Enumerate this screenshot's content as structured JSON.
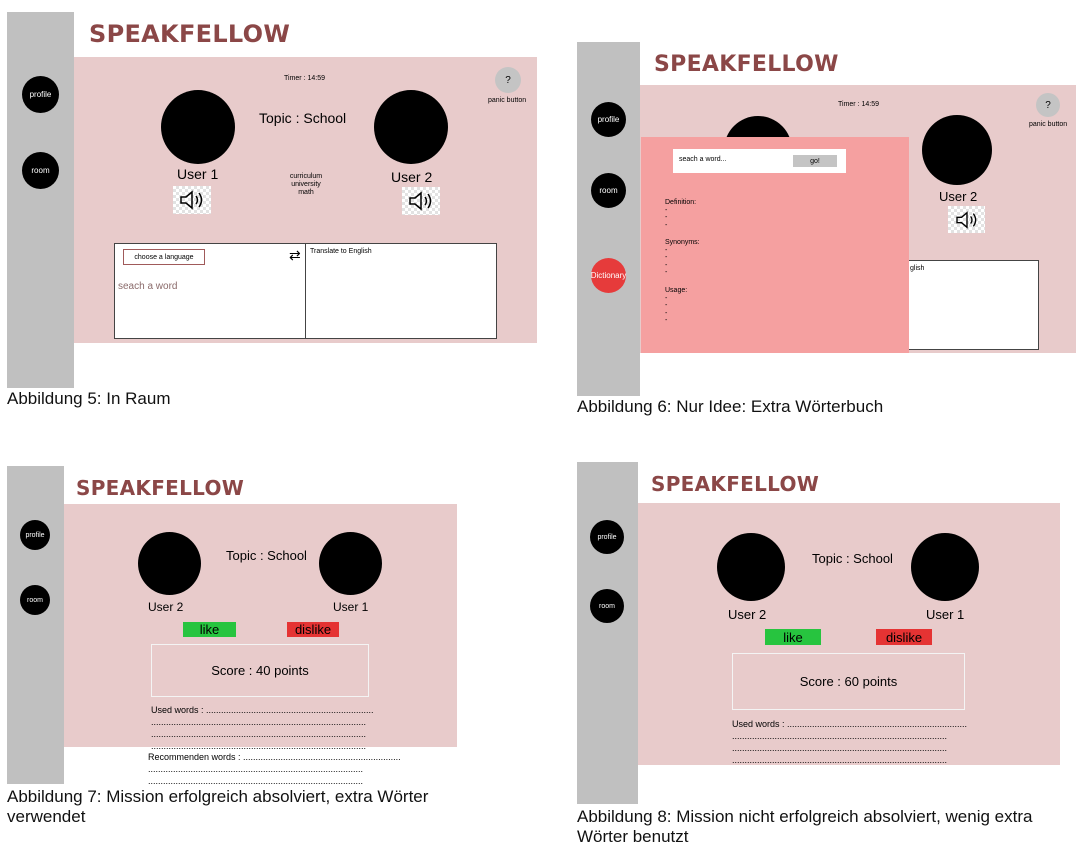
{
  "brand": "SPEAKFELLOW",
  "nav": {
    "profile": "profile",
    "room": "room",
    "dictionary": "Dictionary"
  },
  "fig5": {
    "timer": "Timer : 14:59",
    "panic_icon": "?",
    "panic_label": "panic button",
    "topic": "Topic : School",
    "user_left": "User 1",
    "user_right": "User 2",
    "words": [
      "curriculum",
      "university",
      "math"
    ],
    "language_button": "choose a language",
    "swap_icon": "⇄",
    "search_placeholder": "seach a word",
    "translate_label": "Translate to English",
    "caption": "Abbildung 5: In Raum"
  },
  "fig6": {
    "timer": "Timer : 14:59",
    "panic_icon": "?",
    "panic_label": "panic button",
    "user_right": "User 2",
    "translate_fragment": "glish",
    "search_placeholder": "seach a word...",
    "go_button": "go!",
    "definition_label": "Definition:",
    "synonyms_label": "Synonyms:",
    "usage_label": "Usage:",
    "caption": "Abbildung 6: Nur Idee: Extra Wörterbuch"
  },
  "fig7": {
    "topic": "Topic : School",
    "user_left": "User 2",
    "user_right": "User 1",
    "like": "like",
    "dislike": "dislike",
    "score": "Score : 40 points",
    "used_words": "Used words : ........................................................................",
    "dot_line": "......................................................................................",
    "recommended_words": "Recommenden words : ...............................................................",
    "caption_line1": "Abbildung 7: Mission erfolgreich absolviert, extra Wörter",
    "caption_line2": "verwendet"
  },
  "fig8": {
    "topic": "Topic : School",
    "user_left": "User 2",
    "user_right": "User 1",
    "like": "like",
    "dislike": "dislike",
    "score": "Score : 60 points",
    "used_words": "Used words : ........................................................................",
    "dot_line": "......................................................................................",
    "caption_line1": "Abbildung 8: Mission nicht erfolgreich absolviert, wenig extra",
    "caption_line2": "Wörter benutzt"
  }
}
